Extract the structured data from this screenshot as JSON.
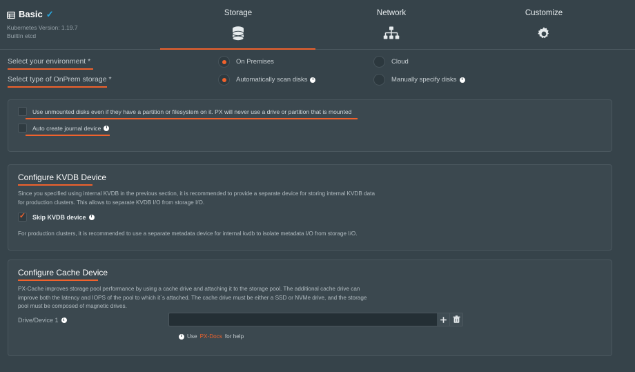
{
  "colors": {
    "accent": "#f1622c",
    "page_bg": "#36434a",
    "panel_bg": "#3b484f",
    "check_blue": "#29a8e0"
  },
  "header": {
    "mode_label": "Basic",
    "mode_icon": "table-icon",
    "verified_icon": "check-icon",
    "kubernetes_version": "Kubernetes Version: 1.19.7",
    "etcd": "BuiltIn etcd",
    "tabs": [
      {
        "label": "Storage",
        "icon": "database-icon",
        "active": true
      },
      {
        "label": "Network",
        "icon": "network-icon",
        "active": false
      },
      {
        "label": "Customize",
        "icon": "gear-icon",
        "active": false
      }
    ]
  },
  "form": {
    "rows": [
      {
        "label": "Select your environment",
        "required": "*",
        "options": [
          {
            "label": "On Premises",
            "selected": true,
            "info": false
          },
          {
            "label": "Cloud",
            "selected": false,
            "info": false
          }
        ]
      },
      {
        "label": "Select type of OnPrem storage",
        "required": "*",
        "options": [
          {
            "label": "Automatically scan disks",
            "selected": true,
            "info": true
          },
          {
            "label": "Manually specify disks",
            "selected": false,
            "info": true
          }
        ]
      }
    ]
  },
  "disk_options": {
    "checkboxes": [
      {
        "label": "Use unmounted disks even if they have a partition or filesystem on it. PX will never use a drive or partition that is mounted",
        "checked": false,
        "info": false
      },
      {
        "label": "Auto create journal device",
        "checked": false,
        "info": true
      }
    ]
  },
  "kvdb": {
    "title": "Configure KVDB Device",
    "description": "Since you specified using internal KVDB in the previous section, it is recommended to provide a separate device for storing internal KVDB data for production clusters. This allows to separate KVDB I/O from storage I/O.",
    "checkbox": {
      "label": "Skip KVDB device",
      "checked": true,
      "info": true
    },
    "footnote": "For production clusters, it is recommended to use a separate metadata device for internal kvdb to isolate metadata I/O from storage I/O."
  },
  "cache": {
    "title": "Configure Cache Device",
    "description": "PX-Cache improves storage pool performance by using a cache drive and attaching it to the storage pool. The additional cache drive can improve both the latency and IOPS of the pool to which it`s attached. The cache drive must be either a SSD or NVMe drive, and the storage pool must be composed of magnetic drives.",
    "drive_label": "Drive/Device 1",
    "drive_value": "",
    "drive_placeholder": "",
    "add_icon": "plus-icon",
    "delete_icon": "trash-icon",
    "help_prefix": "Use",
    "help_link": "PX-Docs",
    "help_suffix": "for help"
  }
}
